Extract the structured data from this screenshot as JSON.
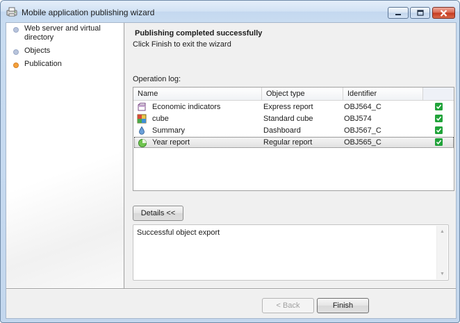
{
  "window": {
    "title": "Mobile application publishing wizard"
  },
  "sidebar": {
    "steps": [
      {
        "label": "Web server and virtual directory",
        "state": "done"
      },
      {
        "label": "Objects",
        "state": "done"
      },
      {
        "label": "Publication",
        "state": "current"
      }
    ]
  },
  "main": {
    "heading": "Publishing completed successfully",
    "subheading": "Click Finish to exit the wizard",
    "operation_log_label": "Operation log:",
    "columns": [
      "Name",
      "Object type",
      "Identifier"
    ],
    "rows": [
      {
        "name": "Economic indicators",
        "type": "Express report",
        "id": "OBJ564_C",
        "icon": "express-report-icon",
        "status": "success"
      },
      {
        "name": "cube",
        "type": "Standard cube",
        "id": "OBJ574",
        "icon": "cube-icon",
        "status": "success"
      },
      {
        "name": "Summary",
        "type": "Dashboard",
        "id": "OBJ567_C",
        "icon": "dashboard-icon",
        "status": "success"
      },
      {
        "name": "Year report",
        "type": "Regular report",
        "id": "OBJ565_C",
        "icon": "regular-report-icon",
        "status": "success"
      }
    ],
    "selected_row": 3,
    "details_button": "Details <<",
    "details_text": "Successful object export"
  },
  "footer": {
    "back_label": "< Back",
    "finish_label": "Finish"
  },
  "colors": {
    "active_step": "#f4a13c",
    "success": "#21a33a"
  }
}
